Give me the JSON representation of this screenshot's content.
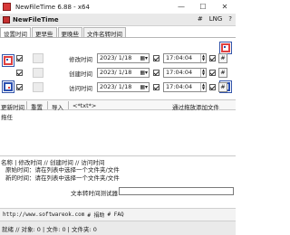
{
  "window": {
    "title": "NewFileTime 6.88 - x64",
    "minimize": "—",
    "maximize": "☐",
    "close": "✕"
  },
  "menubar": {
    "title": "NewFileTime",
    "right_items": [
      "#",
      "LNG",
      "?"
    ]
  },
  "tabs": [
    "设置时间",
    "更早些",
    "更晚些",
    "文件名转时间"
  ],
  "time_rows": [
    {
      "label": "修改时间",
      "date": "2023/ 1/18",
      "time": "17:04:04",
      "checked": true,
      "date_checked": true,
      "time_checked": true
    },
    {
      "label": "创建时间",
      "date": "2023/ 1/18",
      "time": "17:04:04",
      "checked": true,
      "date_checked": true,
      "time_checked": true
    },
    {
      "label": "访问时间",
      "date": "2023/ 1/18",
      "time": "17:04:04",
      "checked": true,
      "date_checked": true,
      "time_checked": true
    }
  ],
  "row_hash_label": "#",
  "toolbar2": {
    "refresh": "更新时间",
    "reset": "重置",
    "import": "导入",
    "export": "<*txt*>",
    "drag_hint": "通过拖放添加文件"
  },
  "file_area": {
    "hint": "拖任"
  },
  "lower": {
    "columns_line": "名称   |   修改时间  //   创建时间  //   访问时间",
    "original_line": "原始时间：请在列表中选择一个文件夹/文件",
    "new_line": "新的时间：请在列表中选择一个文件夹/文件",
    "tester_label": "文本转时间测试器"
  },
  "linkbar": {
    "url": "http://www.softwareok.com",
    "donate": "# 捐助",
    "faq": "# FAQ"
  },
  "statusbar": {
    "text": "就绪  // 对象: 0 | 文件: 0 | 文件夹: 0"
  }
}
